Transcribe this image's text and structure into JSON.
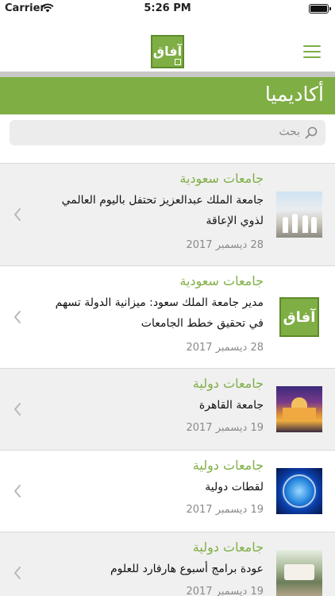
{
  "status_bar": {
    "carrier": "Carrier",
    "time": "5:26 PM",
    "wifi_icon": "wifi-icon",
    "battery_icon": "battery-icon",
    "battery_level": 1.0
  },
  "nav": {
    "logo_text": "آفاق",
    "menu_icon": "hamburger-menu-icon"
  },
  "colors": {
    "accent": "#7fae45",
    "divider": "#c9c9c9",
    "row_gray": "#f0f0f0"
  },
  "section": {
    "title": "أكاديميا"
  },
  "search": {
    "placeholder": "بحث",
    "icon": "search-icon"
  },
  "articles": [
    {
      "category": "جامعات سعودية",
      "headline": "جامعة الملك عبدالعزيز تحتفل باليوم العالمي لذوي الإعاقة",
      "date": "28 ديسمبر 2017",
      "thumb": "event-photo"
    },
    {
      "category": "جامعات سعودية",
      "headline": "مدير جامعة الملك سعود: ميزانية الدولة تسهم في تحقيق خطط الجامعات",
      "date": "28 ديسمبر 2017",
      "thumb": "afaq-logo"
    },
    {
      "category": "جامعات دولية",
      "headline": "جامعة القاهرة",
      "date": "19 ديسمبر 2017",
      "thumb": "cairo-university-photo"
    },
    {
      "category": "جامعات دولية",
      "headline": "لقطات دولية",
      "date": "19 ديسمبر 2017",
      "thumb": "globe-image"
    },
    {
      "category": "جامعات دولية",
      "headline": "عودة برامج أسبوع هارفارد للعلوم",
      "date": "19 ديسمبر 2017",
      "thumb": "fair-photo"
    }
  ]
}
